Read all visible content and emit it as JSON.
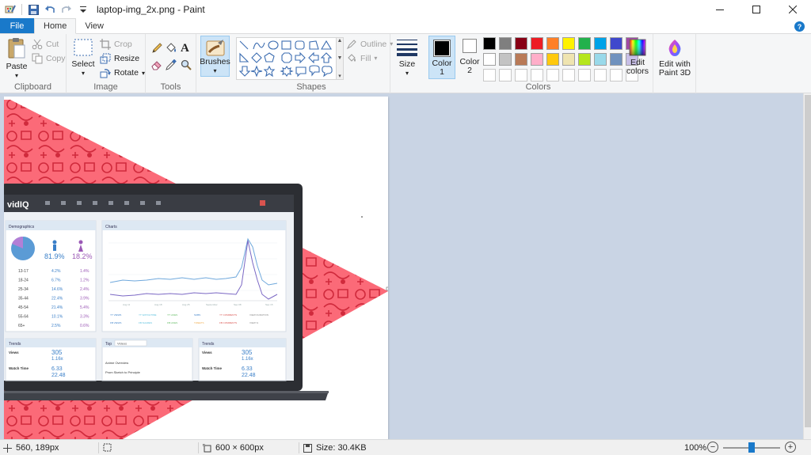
{
  "window": {
    "title": "laptop-img_2x.png - Paint",
    "minimize": "—",
    "maximize": "☐",
    "close": "✕"
  },
  "tabs": [
    {
      "label": "File"
    },
    {
      "label": "Home"
    },
    {
      "label": "View"
    }
  ],
  "help": "?",
  "clipboard": {
    "group_label": "Clipboard",
    "paste": "Paste",
    "cut": "Cut",
    "copy": "Copy"
  },
  "image": {
    "group_label": "Image",
    "select": "Select",
    "crop": "Crop",
    "resize": "Resize",
    "rotate": "Rotate"
  },
  "tools": {
    "group_label": "Tools"
  },
  "brushes": {
    "label": "Brushes"
  },
  "shapes": {
    "group_label": "Shapes",
    "outline": "Outline",
    "fill": "Fill"
  },
  "size": {
    "label": "Size"
  },
  "colors": {
    "group_label": "Colors",
    "color1": "Color\n1",
    "color1_line1": "Color",
    "color1_line2": "1",
    "color2_line1": "Color",
    "color2_line2": "2",
    "edit_colors_line1": "Edit",
    "edit_colors_line2": "colors",
    "color1_value": "#000000",
    "color2_value": "#ffffff",
    "palette_row1": [
      "#000000",
      "#7f7f7f",
      "#880015",
      "#ed1c24",
      "#ff7f27",
      "#fff200",
      "#22b14c",
      "#00a2e8",
      "#3f48cc",
      "#a349a4"
    ],
    "palette_row2": [
      "#ffffff",
      "#c3c3c3",
      "#b97a57",
      "#ffaec9",
      "#ffc90e",
      "#efe4b0",
      "#b5e61d",
      "#99d9ea",
      "#7092be",
      "#c8bfe7"
    ]
  },
  "paint3d": {
    "line1": "Edit with",
    "line2": "Paint 3D"
  },
  "canvas_image": {
    "logo": "vidIQ",
    "panel_demographics": "Demographics",
    "panel_charts": "Charts",
    "pct_male": "81.9%",
    "pct_female": "18.2%",
    "age_rows": [
      {
        "age": "13-17",
        "m": "4.2%",
        "f": "1.4%"
      },
      {
        "age": "18-24",
        "m": "6.7%",
        "f": "1.2%"
      },
      {
        "age": "25-34",
        "m": "14.6%",
        "f": "2.4%"
      },
      {
        "age": "35-44",
        "m": "22.4%",
        "f": "3.9%"
      },
      {
        "age": "45-54",
        "m": "21.4%",
        "f": "5.4%"
      },
      {
        "age": "55-64",
        "m": "10.1%",
        "f": "3.3%"
      },
      {
        "age": "65+",
        "m": "2.5%",
        "f": "0.6%"
      }
    ],
    "panel_trends": "Trends",
    "panel_top": "Top",
    "trend_views": "305",
    "trend_views_sub": "1.16x",
    "trend_watch": "6.33",
    "trend_watch2": "22.48",
    "label_views": "Views",
    "label_watch_time": "Watch Time",
    "top_videos": "Videos",
    "top_row1": "Anime Overview",
    "top_row2": "Prom Sketch to Principle"
  },
  "status": {
    "cursor": "560, 189px",
    "dimensions": "600 × 600px",
    "size": "Size: 30.4KB",
    "zoom": "100%",
    "zoom_level": 1.0
  }
}
